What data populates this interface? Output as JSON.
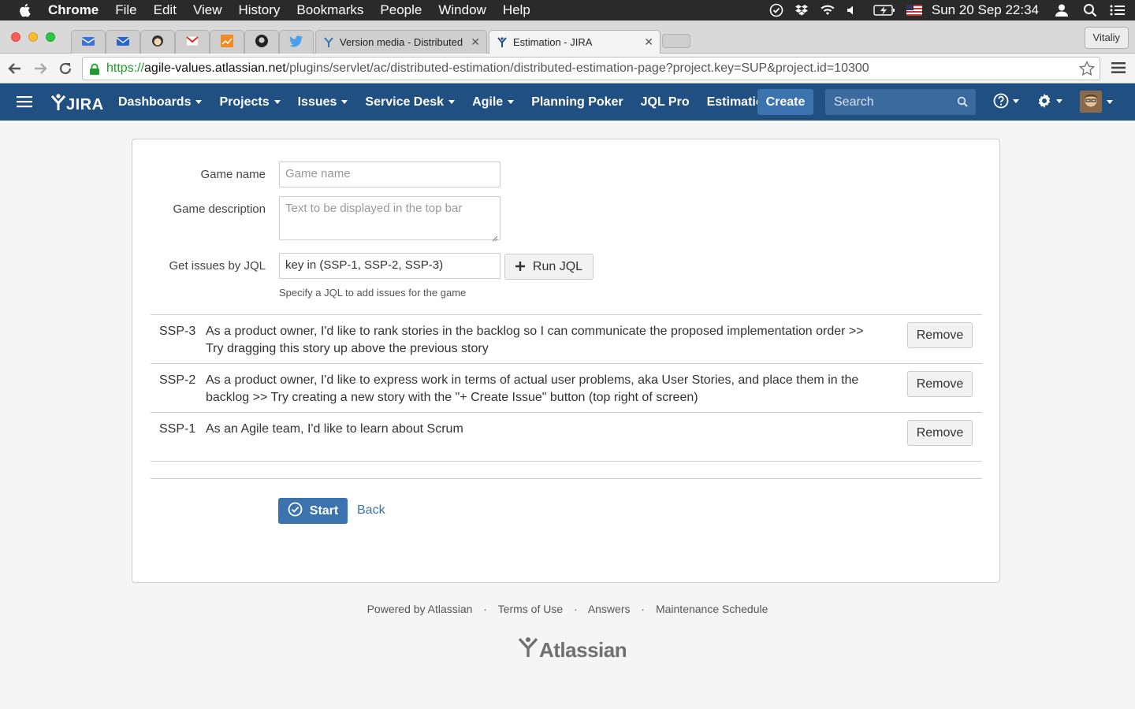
{
  "menubar": {
    "app": "Chrome",
    "items": [
      "File",
      "Edit",
      "View",
      "History",
      "Bookmarks",
      "People",
      "Window",
      "Help"
    ],
    "clock": "Sun 20 Sep  22:34"
  },
  "tabs": {
    "inactive_title": "Version media - Distributed E",
    "active_title": "Estimation - JIRA",
    "profile": "Vitaliy"
  },
  "address": {
    "scheme": "https://",
    "host": "agile-values.atlassian.net",
    "path": "/plugins/servlet/ac/distributed-estimation/distributed-estimation-page?project.key=SUP&project.id=10300"
  },
  "jira": {
    "logo": "JIRA",
    "nav": {
      "dashboards": "Dashboards",
      "projects": "Projects",
      "issues": "Issues",
      "service_desk": "Service Desk",
      "agile": "Agile",
      "planning_poker": "Planning Poker",
      "jql_pro": "JQL Pro",
      "estimation": "Estimation"
    },
    "create": "Create",
    "search_placeholder": "Search"
  },
  "form": {
    "game_name_label": "Game name",
    "game_name_placeholder": "Game name",
    "game_desc_label": "Game description",
    "game_desc_placeholder": "Text to be displayed in the top bar",
    "jql_label": "Get issues by JQL",
    "jql_value": "key in (SSP-1, SSP-2, SSP-3)",
    "run_jql": "Run JQL",
    "hint": "Specify a JQL to add issues for the game"
  },
  "issues": [
    {
      "key": "SSP-3",
      "summary": "As a product owner, I'd like to rank stories in the backlog so I can communicate the proposed implementation order >> Try dragging this story up above the previous story",
      "action": "Remove"
    },
    {
      "key": "SSP-2",
      "summary": "As a product owner, I'd like to express work in terms of actual user problems, aka User Stories, and place them in the backlog >> Try creating a new story with the \"+ Create Issue\" button (top right of screen)",
      "action": "Remove"
    },
    {
      "key": "SSP-1",
      "summary": "As an Agile team, I'd like to learn about Scrum",
      "action": "Remove"
    }
  ],
  "actions": {
    "start": "Start",
    "back": "Back"
  },
  "footer": {
    "powered": "Powered by Atlassian",
    "terms": "Terms of Use",
    "answers": "Answers",
    "maintenance": "Maintenance Schedule",
    "brand": "Atlassian"
  },
  "colors": {
    "jira_header": "#205081",
    "primary_button": "#3b73af",
    "link": "#3b73af"
  }
}
